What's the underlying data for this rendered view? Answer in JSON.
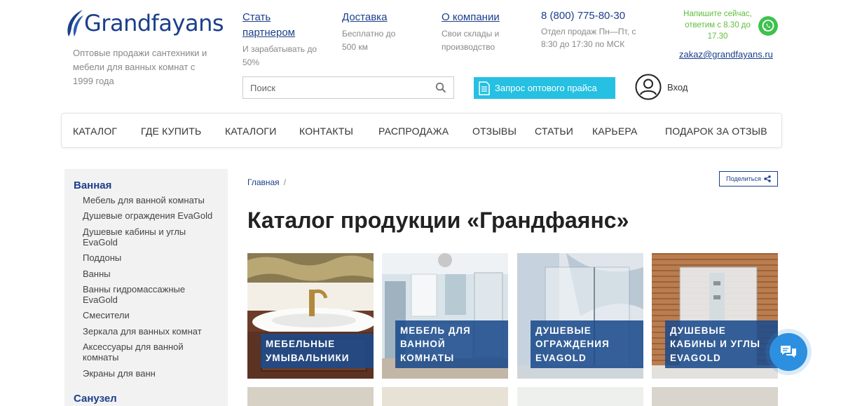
{
  "logo": {
    "text": "Grandfayans"
  },
  "tagline": "Оптовые продажи сантехники и мебели для ванных комнат с 1999 года",
  "header_links": [
    {
      "title": "Стать партнером",
      "sub": "И зарабатывать до 50%"
    },
    {
      "title": "Доставка",
      "sub": "Бесплатно до 500 км"
    },
    {
      "title": "О компании",
      "sub": "Свои склады и производство"
    }
  ],
  "contact": {
    "phone": "8 (800) 775-80-30",
    "hours": "Отдел продаж Пн—Пт, с 8:30 до 17:30 по МСК",
    "whatsapp_text": "Напишите сейчас, ответим с 8.30 до 17.30",
    "email": "zakaz@grandfayans.ru"
  },
  "search": {
    "placeholder": "Поиск"
  },
  "price_button": "Запрос оптового прайса",
  "login": "Вход",
  "nav": [
    "КАТАЛОГ",
    "ГДЕ КУПИТЬ",
    "КАТАЛОГИ",
    "КОНТАКТЫ",
    "РАСПРОДАЖА",
    "ОТЗЫВЫ",
    "СТАТЬИ",
    "КАРЬЕРА",
    "ПОДАРОК ЗА ОТЗЫВ"
  ],
  "sidebar": {
    "category1": "Ванная",
    "items": [
      "Мебель для ванной комнаты",
      "Душевые ограждения EvaGold",
      "Душевые кабины и углы EvaGold",
      "Поддоны",
      "Ванны",
      "Ванны гидромассажные EvaGold",
      "Смесители",
      "Зеркала для ванных комнат",
      "Аксессуары для ванной комнаты",
      "Экраны для ванн"
    ],
    "category2": "Санузел"
  },
  "breadcrumb": {
    "home": "Главная",
    "sep": "/"
  },
  "share": "Поделиться",
  "page_title": "Каталог продукции «Грандфаянс»",
  "cards": [
    {
      "label": "Мебельные умывальники"
    },
    {
      "label": "Мебель для ванной комнаты"
    },
    {
      "label": "Душевые ограждения EvaGold"
    },
    {
      "label": "Душевые кабины и углы EvaGold"
    }
  ],
  "colors": {
    "brand": "#1b3f8b",
    "accent": "#25c0e2",
    "whatsapp": "#3cc24d",
    "chat": "#2d8fe0"
  }
}
